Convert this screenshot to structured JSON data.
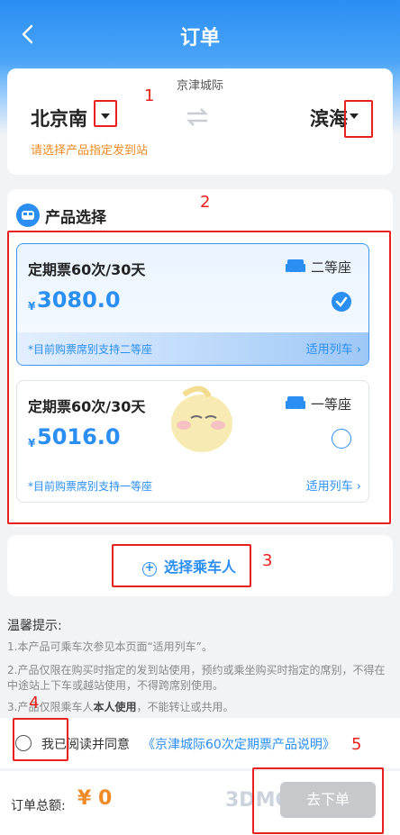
{
  "header": {
    "title": "订单"
  },
  "route": {
    "line_name": "京津城际",
    "from_station": "北京南",
    "to_station": "滨海",
    "hint": "请选择产品指定发到站"
  },
  "products": {
    "section_title": "产品选择",
    "items": [
      {
        "name": "定期票60次/30天",
        "seat_class": "二等座",
        "currency": "¥",
        "price": "3080.0",
        "selected": true,
        "note": "*目前购票席别支持二等座",
        "link": "适用列车 ›"
      },
      {
        "name": "定期票60次/30天",
        "seat_class": "一等座",
        "currency": "¥",
        "price": "5016.0",
        "selected": false,
        "note": "*目前购票席别支持一等座",
        "link": "适用列车 ›"
      }
    ]
  },
  "passenger": {
    "plus": "+",
    "label": "选择乘车人"
  },
  "tips": {
    "title": "温馨提示:",
    "t1": "1.本产品可乘车次参见本页面“适用列车”。",
    "t2": "2.产品仅限在购买时指定的发到站使用，预约或乘坐购买时指定的席别，不得在中途站上下车或越站使用，不得跨席别使用。",
    "t3a": "3.产品仅限乘车人",
    "t3b": "本人使用",
    "t3c": "，不能转让或共用。"
  },
  "agreement": {
    "text": "我已阅读并同意",
    "link": "《京津城际60次定期票产品说明》"
  },
  "footer": {
    "total_label": "订单总额:",
    "total_value": "¥ 0",
    "submit_label": "去下单",
    "watermark": "3DMGAME"
  },
  "annotations": [
    "1",
    "2",
    "3",
    "4",
    "5"
  ],
  "colors": {
    "primary": "#2a8ef3",
    "accent": "#f08a24",
    "annotation": "#e8211c"
  }
}
